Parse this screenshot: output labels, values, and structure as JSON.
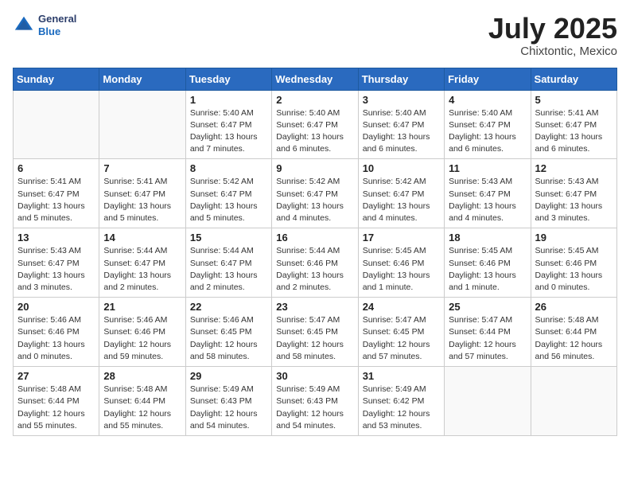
{
  "header": {
    "logo": {
      "general": "General",
      "blue": "Blue"
    },
    "month": "July 2025",
    "location": "Chixtontic, Mexico"
  },
  "weekdays": [
    "Sunday",
    "Monday",
    "Tuesday",
    "Wednesday",
    "Thursday",
    "Friday",
    "Saturday"
  ],
  "weeks": [
    [
      {
        "day": "",
        "info": ""
      },
      {
        "day": "",
        "info": ""
      },
      {
        "day": "1",
        "info": "Sunrise: 5:40 AM\nSunset: 6:47 PM\nDaylight: 13 hours\nand 7 minutes."
      },
      {
        "day": "2",
        "info": "Sunrise: 5:40 AM\nSunset: 6:47 PM\nDaylight: 13 hours\nand 6 minutes."
      },
      {
        "day": "3",
        "info": "Sunrise: 5:40 AM\nSunset: 6:47 PM\nDaylight: 13 hours\nand 6 minutes."
      },
      {
        "day": "4",
        "info": "Sunrise: 5:40 AM\nSunset: 6:47 PM\nDaylight: 13 hours\nand 6 minutes."
      },
      {
        "day": "5",
        "info": "Sunrise: 5:41 AM\nSunset: 6:47 PM\nDaylight: 13 hours\nand 6 minutes."
      }
    ],
    [
      {
        "day": "6",
        "info": "Sunrise: 5:41 AM\nSunset: 6:47 PM\nDaylight: 13 hours\nand 5 minutes."
      },
      {
        "day": "7",
        "info": "Sunrise: 5:41 AM\nSunset: 6:47 PM\nDaylight: 13 hours\nand 5 minutes."
      },
      {
        "day": "8",
        "info": "Sunrise: 5:42 AM\nSunset: 6:47 PM\nDaylight: 13 hours\nand 5 minutes."
      },
      {
        "day": "9",
        "info": "Sunrise: 5:42 AM\nSunset: 6:47 PM\nDaylight: 13 hours\nand 4 minutes."
      },
      {
        "day": "10",
        "info": "Sunrise: 5:42 AM\nSunset: 6:47 PM\nDaylight: 13 hours\nand 4 minutes."
      },
      {
        "day": "11",
        "info": "Sunrise: 5:43 AM\nSunset: 6:47 PM\nDaylight: 13 hours\nand 4 minutes."
      },
      {
        "day": "12",
        "info": "Sunrise: 5:43 AM\nSunset: 6:47 PM\nDaylight: 13 hours\nand 3 minutes."
      }
    ],
    [
      {
        "day": "13",
        "info": "Sunrise: 5:43 AM\nSunset: 6:47 PM\nDaylight: 13 hours\nand 3 minutes."
      },
      {
        "day": "14",
        "info": "Sunrise: 5:44 AM\nSunset: 6:47 PM\nDaylight: 13 hours\nand 2 minutes."
      },
      {
        "day": "15",
        "info": "Sunrise: 5:44 AM\nSunset: 6:47 PM\nDaylight: 13 hours\nand 2 minutes."
      },
      {
        "day": "16",
        "info": "Sunrise: 5:44 AM\nSunset: 6:46 PM\nDaylight: 13 hours\nand 2 minutes."
      },
      {
        "day": "17",
        "info": "Sunrise: 5:45 AM\nSunset: 6:46 PM\nDaylight: 13 hours\nand 1 minute."
      },
      {
        "day": "18",
        "info": "Sunrise: 5:45 AM\nSunset: 6:46 PM\nDaylight: 13 hours\nand 1 minute."
      },
      {
        "day": "19",
        "info": "Sunrise: 5:45 AM\nSunset: 6:46 PM\nDaylight: 13 hours\nand 0 minutes."
      }
    ],
    [
      {
        "day": "20",
        "info": "Sunrise: 5:46 AM\nSunset: 6:46 PM\nDaylight: 13 hours\nand 0 minutes."
      },
      {
        "day": "21",
        "info": "Sunrise: 5:46 AM\nSunset: 6:46 PM\nDaylight: 12 hours\nand 59 minutes."
      },
      {
        "day": "22",
        "info": "Sunrise: 5:46 AM\nSunset: 6:45 PM\nDaylight: 12 hours\nand 58 minutes."
      },
      {
        "day": "23",
        "info": "Sunrise: 5:47 AM\nSunset: 6:45 PM\nDaylight: 12 hours\nand 58 minutes."
      },
      {
        "day": "24",
        "info": "Sunrise: 5:47 AM\nSunset: 6:45 PM\nDaylight: 12 hours\nand 57 minutes."
      },
      {
        "day": "25",
        "info": "Sunrise: 5:47 AM\nSunset: 6:44 PM\nDaylight: 12 hours\nand 57 minutes."
      },
      {
        "day": "26",
        "info": "Sunrise: 5:48 AM\nSunset: 6:44 PM\nDaylight: 12 hours\nand 56 minutes."
      }
    ],
    [
      {
        "day": "27",
        "info": "Sunrise: 5:48 AM\nSunset: 6:44 PM\nDaylight: 12 hours\nand 55 minutes."
      },
      {
        "day": "28",
        "info": "Sunrise: 5:48 AM\nSunset: 6:44 PM\nDaylight: 12 hours\nand 55 minutes."
      },
      {
        "day": "29",
        "info": "Sunrise: 5:49 AM\nSunset: 6:43 PM\nDaylight: 12 hours\nand 54 minutes."
      },
      {
        "day": "30",
        "info": "Sunrise: 5:49 AM\nSunset: 6:43 PM\nDaylight: 12 hours\nand 54 minutes."
      },
      {
        "day": "31",
        "info": "Sunrise: 5:49 AM\nSunset: 6:42 PM\nDaylight: 12 hours\nand 53 minutes."
      },
      {
        "day": "",
        "info": ""
      },
      {
        "day": "",
        "info": ""
      }
    ]
  ]
}
